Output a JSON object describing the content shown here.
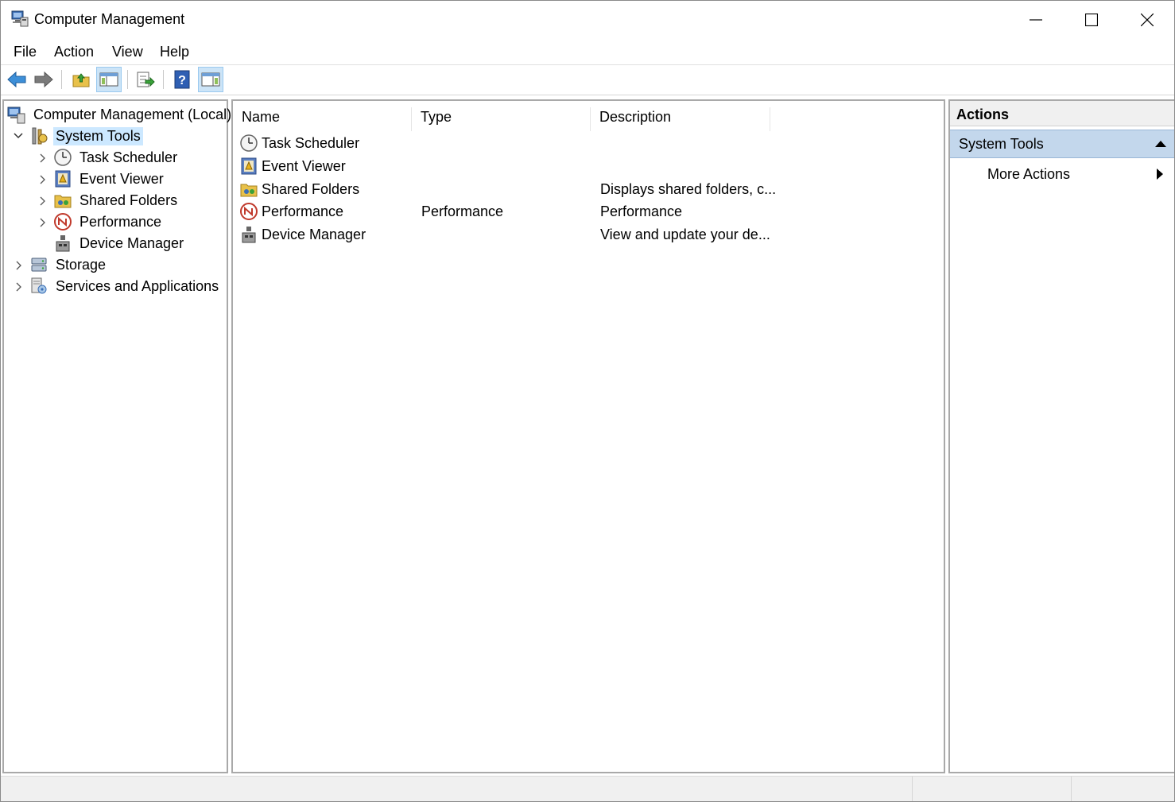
{
  "window": {
    "title": "Computer Management"
  },
  "menu": [
    "File",
    "Action",
    "View",
    "Help"
  ],
  "toolbar": {
    "buttons": [
      "back-arrow-icon",
      "forward-arrow-icon",
      "up-folder-icon",
      "show-hide-console-tree-icon",
      "export-list-icon",
      "help-icon",
      "show-hide-action-pane-icon"
    ]
  },
  "tree": {
    "root": "Computer Management (Local)",
    "system_tools": "System Tools",
    "children": [
      "Task Scheduler",
      "Event Viewer",
      "Shared Folders",
      "Performance",
      "Device Manager"
    ],
    "storage": "Storage",
    "services": "Services and Applications"
  },
  "list": {
    "columns": [
      "Name",
      "Type",
      "Description"
    ],
    "rows": [
      {
        "name": "Task Scheduler",
        "type": "",
        "description": ""
      },
      {
        "name": "Event Viewer",
        "type": "",
        "description": ""
      },
      {
        "name": "Shared Folders",
        "type": "",
        "description": "Displays shared folders, c..."
      },
      {
        "name": "Performance",
        "type": "Performance",
        "description": "Performance"
      },
      {
        "name": "Device Manager",
        "type": "",
        "description": "View and update your de..."
      }
    ]
  },
  "actions": {
    "title": "Actions",
    "group": "System Tools",
    "more": "More Actions"
  },
  "colors": {
    "selection": "#cce8ff",
    "actions_group": "#c3d7ec",
    "pressed": "#cce4f7"
  }
}
